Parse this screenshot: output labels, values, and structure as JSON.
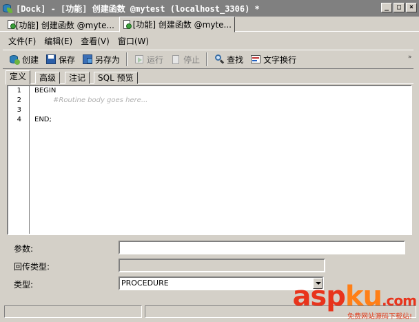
{
  "window": {
    "title": "[Dock] - [功能] 创建函数 @mytest (localhost_3306) *",
    "buttons": {
      "minimize": "_",
      "maximize": "□",
      "close": "×"
    }
  },
  "doc_tabs": [
    {
      "label": "[功能] 创建函数 @myte...",
      "active": false
    },
    {
      "label": "[功能] 创建函数 @myte...",
      "active": true
    }
  ],
  "menu": [
    "文件(F)",
    "编辑(E)",
    "查看(V)",
    "窗口(W)"
  ],
  "toolbar": {
    "create": "创建",
    "save": "保存",
    "save_as": "另存为",
    "run": "运行",
    "stop": "停止",
    "find": "查找",
    "word_wrap": "文字换行"
  },
  "sub_tabs": [
    "定义",
    "高级",
    "注记",
    "SQL 预览"
  ],
  "editor": {
    "line_numbers": [
      "1",
      "2",
      "3",
      "4"
    ],
    "lines": [
      "BEGIN",
      "#Routine body goes here...",
      "",
      "END;"
    ]
  },
  "form": {
    "params_label": "参数:",
    "params_value": "",
    "return_type_label": "回传类型:",
    "return_type_value": "",
    "type_label": "类型:",
    "type_value": "PROCEDURE"
  },
  "watermark": {
    "asp": "asp",
    "ku": "ku",
    "com": ".com",
    "sub": "免费网站源码下载站!"
  },
  "colors": {
    "title_bar": "#808080",
    "face": "#d4d0c8",
    "watermark_red": "#e8341c",
    "watermark_orange": "#ff7f17"
  }
}
